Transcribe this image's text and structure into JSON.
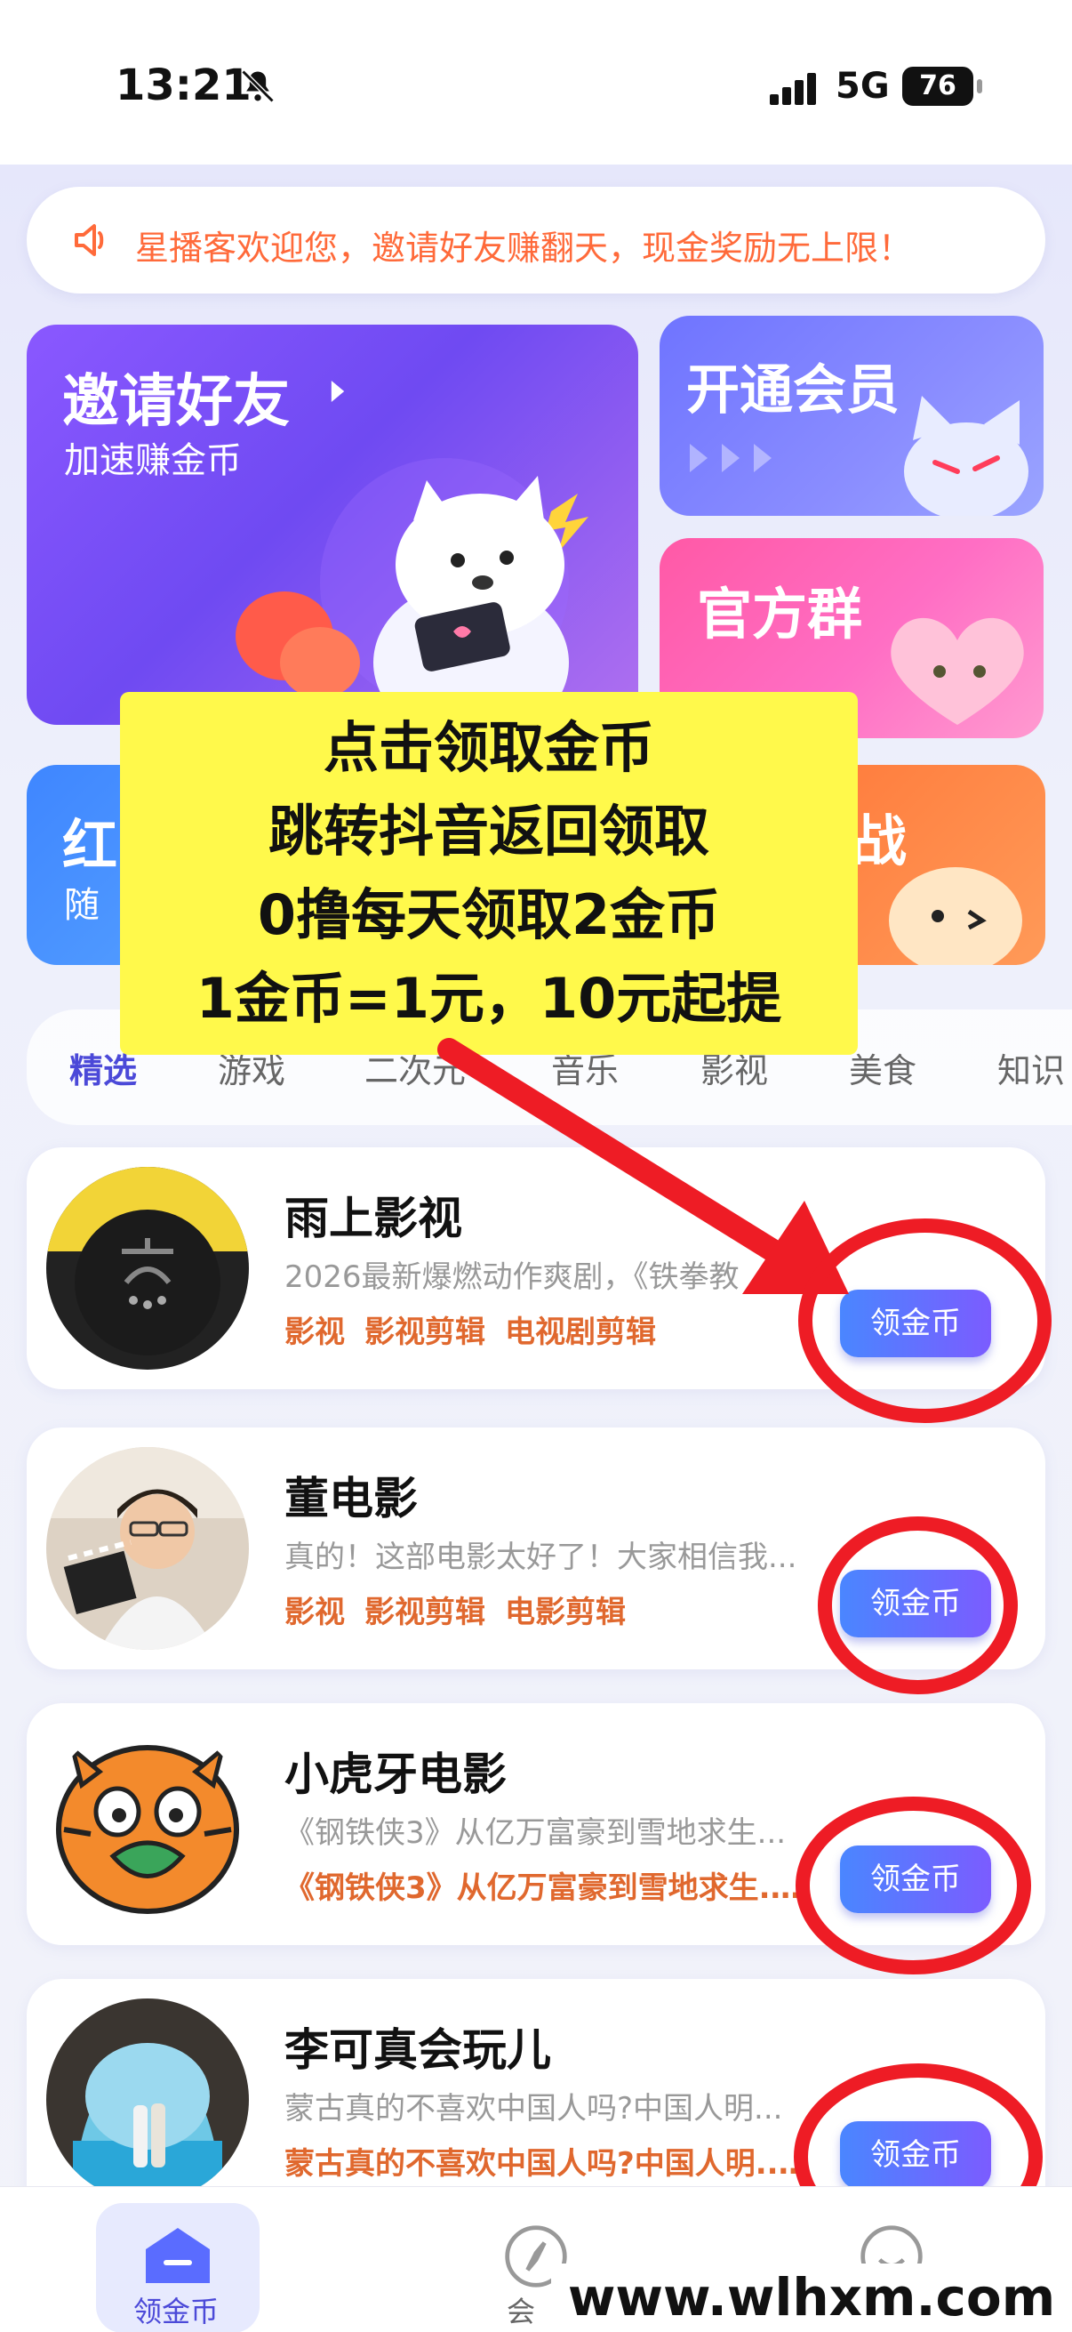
{
  "status_bar": {
    "time": "13:21",
    "network": "5G",
    "battery": "76"
  },
  "notice": {
    "text": "星播客欢迎您，邀请好友赚翻天，现金奖励无上限！"
  },
  "cards": {
    "invite": {
      "title": "邀请好友",
      "subtitle": "加速赚金币"
    },
    "vip": {
      "title": "开通会员"
    },
    "group": {
      "title": "官方群"
    },
    "red": {
      "title": "红",
      "subtitle": "随"
    },
    "battle": {
      "title": "大战"
    }
  },
  "overlay": {
    "lines": [
      "点击领取金币",
      "跳转抖音返回领取",
      "0撸每天领取2金币",
      "1金币=1元，10元起提"
    ]
  },
  "tabs": [
    "精选",
    "游戏",
    "二次元",
    "音乐",
    "影视",
    "美食",
    "知识"
  ],
  "items": [
    {
      "name": "雨上影视",
      "desc": "2026最新爆燃动作爽剧，《铁拳教",
      "tags": [
        "影视",
        "影视剪辑",
        "电视剧剪辑"
      ],
      "button": "领金币"
    },
    {
      "name": "董电影",
      "desc": "真的！这部电影太好了！大家相信我...",
      "tags": [
        "影视",
        "影视剪辑",
        "电影剪辑"
      ],
      "button": "领金币"
    },
    {
      "name": "小虎牙电影",
      "desc": "《钢铁侠3》从亿万富豪到雪地求生...",
      "tags": [
        "《钢铁侠3》从亿万富豪到雪地求生..."
      ],
      "button": "领金币"
    },
    {
      "name": "李可真会玩儿",
      "desc": "蒙古真的不喜欢中国人吗?中国人明...",
      "tags": [
        "蒙古真的不喜欢中国人吗?中国人明..."
      ],
      "button": "领金币"
    }
  ],
  "bottom_nav": {
    "coins": "领金币",
    "member": "会"
  },
  "watermark": "www.wlhxm.com",
  "colors": {
    "accent": "#4b49d8",
    "notice": "#ff6a3a",
    "tag": "#e0682e",
    "annotation_red": "#ee1c25",
    "overlay_yellow": "#fff94b"
  }
}
